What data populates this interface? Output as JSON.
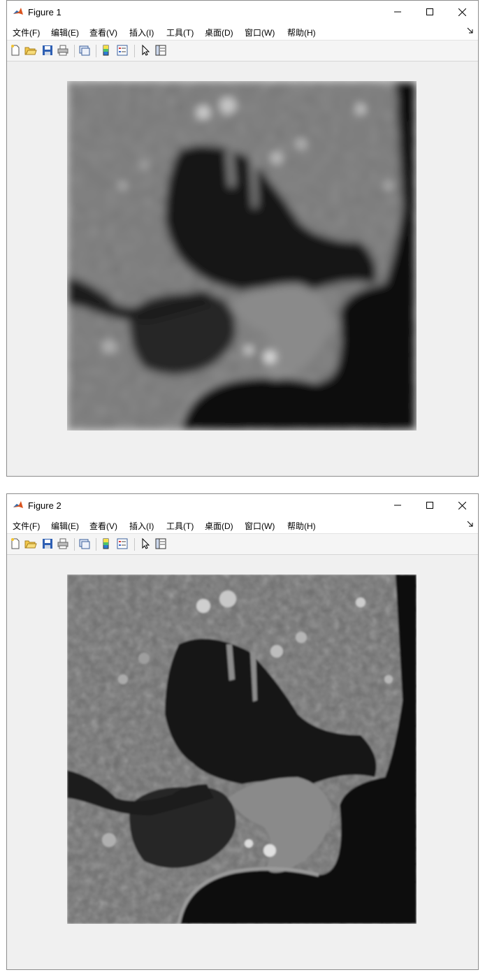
{
  "windows": [
    {
      "title": "Figure 1",
      "menu": [
        "文件(F)",
        "编辑(E)",
        "查看(V)",
        "插入(I)",
        "工具(T)",
        "桌面(D)",
        "窗口(W)",
        "帮助(H)"
      ],
      "image": "blurred grayscale aerial image of a coastline and bay"
    },
    {
      "title": "Figure 2",
      "menu": [
        "文件(F)",
        "编辑(E)",
        "查看(V)",
        "插入(I)",
        "工具(T)",
        "桌面(D)",
        "窗口(W)",
        "帮助(H)"
      ],
      "image": "sharpened grayscale aerial image of a coastline and bay"
    }
  ],
  "toolbar_icons": [
    "new-figure-icon",
    "open-file-icon",
    "save-icon",
    "print-icon",
    "link-plot-icon",
    "insert-colorbar-icon",
    "insert-legend-icon",
    "edit-plot-cursor-icon",
    "property-inspector-icon"
  ]
}
